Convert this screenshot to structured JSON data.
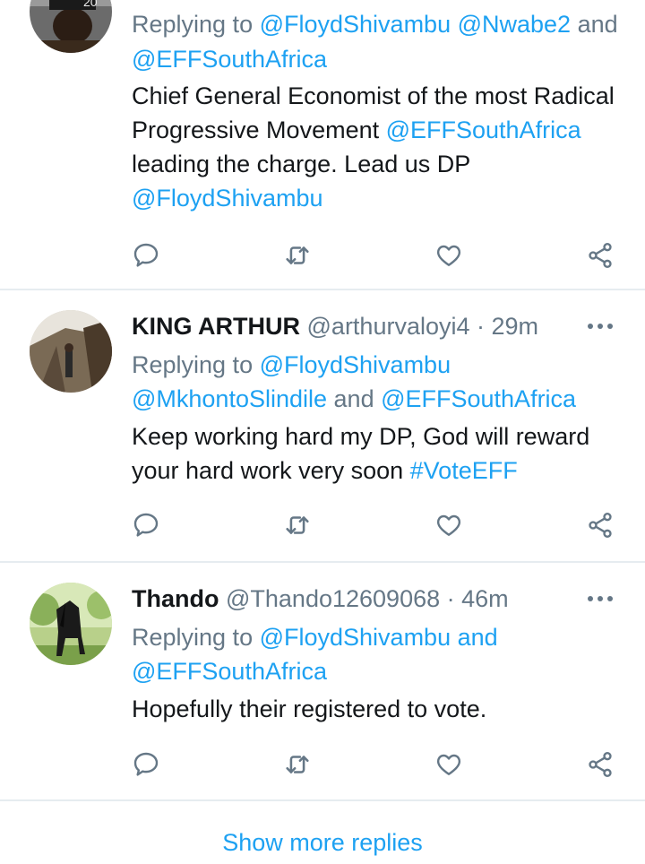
{
  "tweets": [
    {
      "name": "",
      "handle": "",
      "time": "",
      "replying_prefix": "Replying to",
      "replying_html_parts": [
        {
          "t": "Replying to ",
          "c": "replying"
        },
        {
          "t": "@FloydShivambu @Nwabe2",
          "c": "link"
        },
        {
          "t": " and ",
          "c": "replying"
        },
        {
          "t": "@EFFSouthAfrica",
          "c": "link"
        }
      ],
      "text_parts": [
        {
          "t": "Chief General Economist of the most Radical Progressive Movement ",
          "c": "text"
        },
        {
          "t": "@EFFSouthAfrica",
          "c": "link"
        },
        {
          "t": " leading the charge. Lead us DP ",
          "c": "text"
        },
        {
          "t": "@FloydShivambu",
          "c": "link"
        }
      ]
    },
    {
      "name": "KING ARTHUR",
      "handle": "@arthurvaloyi4",
      "time": "· 29m",
      "replying_html_parts": [
        {
          "t": "Replying to ",
          "c": "replying"
        },
        {
          "t": "@FloydShivambu @MkhontoSlindile",
          "c": "link"
        },
        {
          "t": " and ",
          "c": "replying"
        },
        {
          "t": "@EFFSouthAfrica",
          "c": "link"
        }
      ],
      "text_parts": [
        {
          "t": "Keep working hard my DP, God will reward your hard work very soon ",
          "c": "text"
        },
        {
          "t": "#VoteEFF",
          "c": "link"
        }
      ]
    },
    {
      "name": "Thando",
      "handle": "@Thando12609068",
      "time": "· 46m",
      "replying_html_parts": [
        {
          "t": "Replying to ",
          "c": "replying"
        },
        {
          "t": "@FloydShivambu",
          "c": "link"
        },
        {
          "t": " and ",
          "c": "replying"
        },
        {
          "t": "@EFFSouthAfrica",
          "c": "link"
        }
      ],
      "text_parts": [
        {
          "t": "Hopefully their registered to vote.",
          "c": "text"
        }
      ]
    }
  ],
  "icons": {
    "reply": "reply-icon",
    "retweet": "retweet-icon",
    "like": "heart-icon",
    "share": "share-icon",
    "more": "more-options-icon"
  },
  "colors": {
    "link": "#1da1f2",
    "secondary": "#657786",
    "icon": "#657786",
    "divider": "#e6ecf0"
  },
  "footer": {
    "show_more_label": "Show more replies"
  }
}
